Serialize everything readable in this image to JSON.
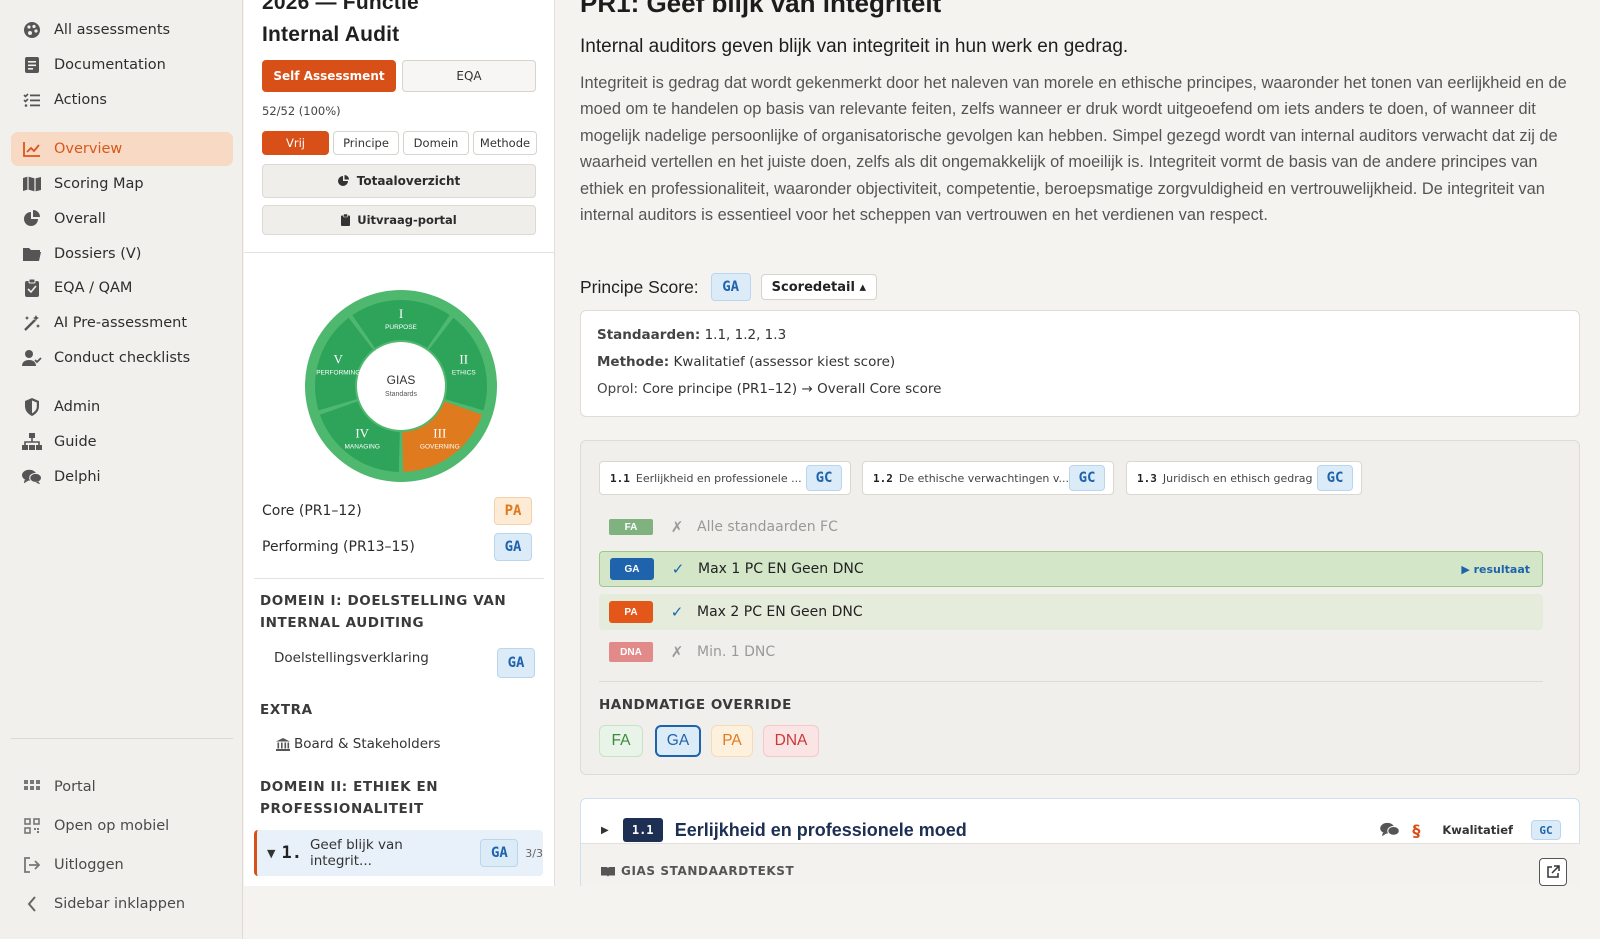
{
  "sidebar": {
    "items": [
      {
        "label": "All assessments",
        "icon": "palette-icon"
      },
      {
        "label": "Documentation",
        "icon": "document-icon"
      },
      {
        "label": "Actions",
        "icon": "checklist-icon"
      },
      {
        "label": "Overview",
        "icon": "chart-line-icon"
      },
      {
        "label": "Scoring Map",
        "icon": "map-icon"
      },
      {
        "label": "Overall",
        "icon": "pie-icon"
      },
      {
        "label": "Dossiers (V)",
        "icon": "folder-icon"
      },
      {
        "label": "EQA / QAM",
        "icon": "clipboard-icon"
      },
      {
        "label": "AI Pre-assessment",
        "icon": "magic-wand-icon"
      },
      {
        "label": "Conduct checklists",
        "icon": "user-check-icon"
      },
      {
        "label": "Admin",
        "icon": "shield-icon"
      },
      {
        "label": "Guide",
        "icon": "sitemap-icon"
      },
      {
        "label": "Delphi",
        "icon": "comments-icon"
      }
    ],
    "bottom": [
      {
        "label": "Portal",
        "icon": "grid-icon"
      },
      {
        "label": "Open op mobiel",
        "icon": "qr-icon"
      },
      {
        "label": "Uitloggen",
        "icon": "logout-icon"
      },
      {
        "label": "Sidebar inklappen",
        "icon": "chevron-left-icon"
      }
    ],
    "accent": "#d9571c"
  },
  "mid": {
    "title_line1": "2026 — Functie",
    "title_line2": "Internal Audit",
    "mode_self": "Self Assessment",
    "mode_eqa": "EQA",
    "progress": "52/52 (100%)",
    "filters": [
      "Vrij",
      "Principe",
      "Domein",
      "Methode"
    ],
    "btn_total": "Totaaloverzicht",
    "btn_portal": "Uitvraag-portal",
    "wheel": {
      "center_title": "GIAS",
      "center_sub": "Standards",
      "segments": [
        {
          "numeral": "I",
          "label": "PURPOSE"
        },
        {
          "numeral": "II",
          "label": "ETHICS"
        },
        {
          "numeral": "III",
          "label": "GOVERNING"
        },
        {
          "numeral": "IV",
          "label": "MANAGING"
        },
        {
          "numeral": "V",
          "label": "PERFORMING"
        }
      ]
    },
    "scores": [
      {
        "label": "Core (PR1–12)",
        "badge": "PA"
      },
      {
        "label": "Performing (PR13–15)",
        "badge": "GA"
      }
    ],
    "domain1_title": "DOMEIN I: DOELSTELLING VAN INTERNAL AUDITING",
    "domain1_item": "Doelstellingsverklaring",
    "domain1_badge": "GA",
    "extra_title": "EXTRA",
    "extra_item": "Board & Stakeholders",
    "domain2_title": "DOMEIN II: ETHIEK EN PROFESSIONALITEIT",
    "selected_num": "1.",
    "selected_label": "Geef blijk van integrit...",
    "selected_badge": "GA",
    "selected_count": "3/3"
  },
  "main": {
    "title": "PR1: Geef blijk van integriteit",
    "subtitle": "Internal auditors geven blijk van integriteit in hun werk en gedrag.",
    "paragraph": "Integriteit is gedrag dat wordt gekenmerkt door het naleven van morele en ethische principes, waaronder het tonen van eerlijkheid en de moed om te handelen op basis van relevante feiten, zelfs wanneer er druk wordt uitgeoefend om iets anders te doen, of wanneer dit mogelijk nadelige persoonlijke of organisatorische gevolgen kan hebben. Simpel gezegd wordt van internal auditors verwacht dat zij de waarheid vertellen en het juiste doen, zelfs als dit ongemakkelijk of moeilijk is. Integriteit vormt de basis van de andere principes van ethiek en professionaliteit, waaronder objectiviteit, competentie, beroepsmatige zorgvuldigheid en vertrouwelijkheid. De integriteit van internal auditors is essentieel voor het scheppen van vertrouwen en het verdienen van respect.",
    "principle_score_label": "Principe Score:",
    "principle_score_badge": "GA",
    "scoredetail": "Scoredetail ▴",
    "standards_label": "Standaarden:",
    "standards_value": "1.1, 1.2, 1.3",
    "method_label": "Methode:",
    "method_value": "Kwalitatief (assessor kiest score)",
    "oprol_label": "Oprol:",
    "oprol_value": "Core principe (PR1–12) → Overall Core score",
    "standard_tabs": [
      {
        "code": "1.1",
        "label": "Eerlijkheid en professionele ...",
        "badge": "GC"
      },
      {
        "code": "1.2",
        "label": "De ethische verwachtingen v...",
        "badge": "GC"
      },
      {
        "code": "1.3",
        "label": "Juridisch en ethisch gedrag",
        "badge": "GC"
      }
    ],
    "rules": [
      {
        "pill": "FA",
        "mark": "✗",
        "text": "Alle standaarden FC",
        "color": "#7fb27f"
      },
      {
        "pill": "GA",
        "mark": "✓",
        "text": "Max 1 PC EN Geen DNC",
        "color": "#1f63ad",
        "result": "▶ resultaat"
      },
      {
        "pill": "PA",
        "mark": "✓",
        "text": "Max 2 PC EN Geen DNC",
        "color": "#e4571a"
      },
      {
        "pill": "DNA",
        "mark": "✗",
        "text": "Min. 1 DNC",
        "color": "#e28a8a"
      }
    ],
    "override_title": "HANDMATIGE OVERRIDE",
    "override_buttons": [
      "FA",
      "GA",
      "PA",
      "DNA"
    ],
    "std_section_code": "1.1",
    "std_section_title": "Eerlijkheid en professionele moed",
    "std_section_method": "Kwalitatief",
    "std_section_badge": "GC",
    "std_text_label": "GIAS STANDAARDTEKST"
  }
}
